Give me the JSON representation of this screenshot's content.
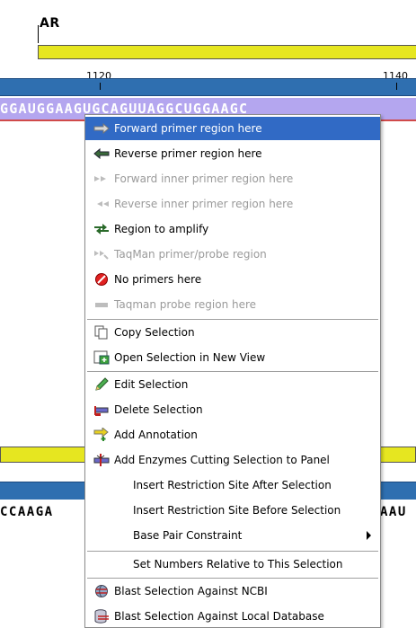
{
  "annotation": {
    "label": "AR"
  },
  "ruler": {
    "labels": [
      "1120",
      "1140"
    ]
  },
  "sequence": {
    "top": "GGAUGGAAGUGCAGUUAGGCUGGAAGC",
    "bottom_left": "CCAAGA",
    "bottom_right": "AAU"
  },
  "menu": {
    "items": [
      {
        "label": "Forward primer region here",
        "icon": "forward-primer-icon",
        "state": "highlighted"
      },
      {
        "label": "Reverse primer region here",
        "icon": "reverse-primer-icon",
        "state": "enabled"
      },
      {
        "label": "Forward inner primer region here",
        "icon": "forward-inner-primer-icon",
        "state": "disabled"
      },
      {
        "label": "Reverse inner primer region here",
        "icon": "reverse-inner-primer-icon",
        "state": "disabled"
      },
      {
        "label": "Region to amplify",
        "icon": "region-amplify-icon",
        "state": "enabled"
      },
      {
        "label": "TaqMan primer/probe region",
        "icon": "taqman-icon",
        "state": "disabled"
      },
      {
        "label": "No primers here",
        "icon": "no-primers-icon",
        "state": "enabled"
      },
      {
        "label": "Taqman probe region here",
        "icon": "taqman-probe-icon",
        "state": "disabled"
      },
      {
        "label": "Copy Selection",
        "icon": "copy-icon",
        "state": "enabled"
      },
      {
        "label": "Open Selection in New View",
        "icon": "open-new-view-icon",
        "state": "enabled"
      },
      {
        "label": "Edit Selection",
        "icon": "edit-pencil-icon",
        "state": "enabled"
      },
      {
        "label": "Delete Selection",
        "icon": "delete-selection-icon",
        "state": "enabled"
      },
      {
        "label": "Add Annotation",
        "icon": "add-annotation-icon",
        "state": "enabled"
      },
      {
        "label": "Add Enzymes Cutting Selection to Panel",
        "icon": "add-enzymes-icon",
        "state": "enabled"
      },
      {
        "label": "Insert Restriction Site After Selection",
        "icon": "",
        "state": "enabled"
      },
      {
        "label": "Insert Restriction Site Before Selection",
        "icon": "",
        "state": "enabled"
      },
      {
        "label": "Base Pair Constraint",
        "icon": "",
        "state": "enabled",
        "submenu": true
      },
      {
        "label": "Set Numbers Relative to This Selection",
        "icon": "",
        "state": "enabled"
      },
      {
        "label": "Blast Selection Against NCBI",
        "icon": "blast-ncbi-icon",
        "state": "enabled"
      },
      {
        "label": "Blast Selection Against Local Database",
        "icon": "blast-local-icon",
        "state": "enabled"
      }
    ]
  },
  "colors": {
    "highlight": "#316ac5",
    "ruler": "#2f6fb0",
    "annotation": "#e6e620",
    "selection": "#b4a6ef"
  }
}
